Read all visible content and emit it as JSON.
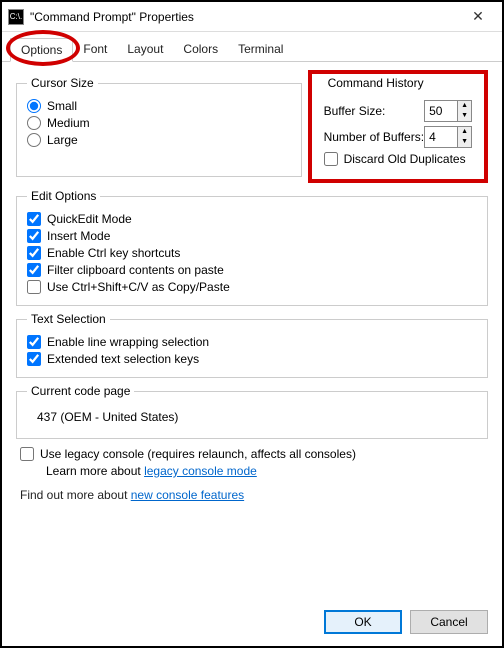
{
  "titlebar": {
    "title": "\"Command Prompt\" Properties",
    "icon_label": "C:\\."
  },
  "tabs": [
    "Options",
    "Font",
    "Layout",
    "Colors",
    "Terminal"
  ],
  "active_tab": "Options",
  "cursor": {
    "legend": "Cursor Size",
    "options": [
      "Small",
      "Medium",
      "Large"
    ],
    "selected": "Small"
  },
  "history": {
    "legend": "Command History",
    "buffer_label": "Buffer Size:",
    "buffer_value": "50",
    "numbuf_label": "Number of Buffers:",
    "numbuf_value": "4",
    "discard_label": "Discard Old Duplicates",
    "discard_checked": false
  },
  "edit": {
    "legend": "Edit Options",
    "items": [
      {
        "label": "QuickEdit Mode",
        "checked": true
      },
      {
        "label": "Insert Mode",
        "checked": true
      },
      {
        "label": "Enable Ctrl key shortcuts",
        "checked": true
      },
      {
        "label": "Filter clipboard contents on paste",
        "checked": true
      },
      {
        "label": "Use Ctrl+Shift+C/V as Copy/Paste",
        "checked": false
      }
    ]
  },
  "textsel": {
    "legend": "Text Selection",
    "items": [
      {
        "label": "Enable line wrapping selection",
        "checked": true
      },
      {
        "label": "Extended text selection keys",
        "checked": true
      }
    ]
  },
  "codepage": {
    "legend": "Current code page",
    "value": "437   (OEM - United States)"
  },
  "legacy": {
    "label": "Use legacy console (requires relaunch, affects all consoles)",
    "checked": false,
    "learn_pre": "Learn more about ",
    "learn_link": "legacy console mode"
  },
  "findout": {
    "pre": "Find out more about ",
    "link": "new console features"
  },
  "buttons": {
    "ok": "OK",
    "cancel": "Cancel"
  }
}
